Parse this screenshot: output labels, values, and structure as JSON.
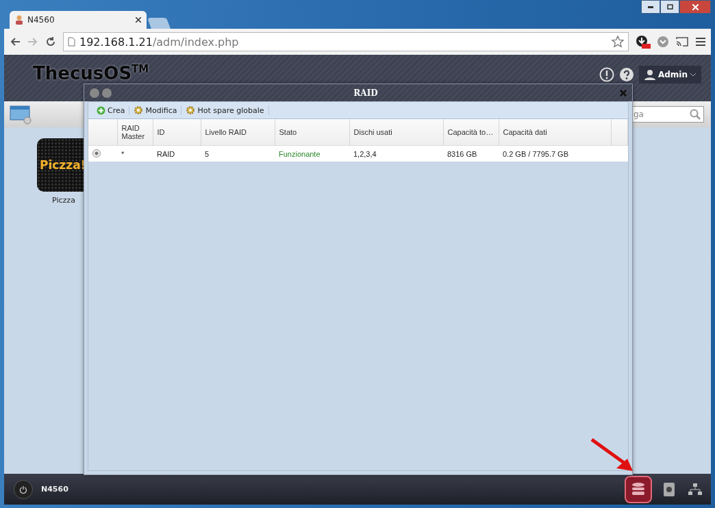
{
  "browser": {
    "tab": {
      "title": "N4560"
    },
    "url": {
      "host": "192.168.1.21",
      "path": "/adm/index.php"
    }
  },
  "header": {
    "logo": "ThecusOS$^{TM}$",
    "user": "Admin"
  },
  "search": {
    "placeholder": "ga"
  },
  "desktop": {
    "apps": [
      {
        "label": "Piczza",
        "logo": "Piczza!"
      }
    ]
  },
  "dialog": {
    "title": "RAID",
    "toolbar": [
      {
        "label": "Crea",
        "kind": "add"
      },
      {
        "label": "Modifica",
        "kind": "edit"
      },
      {
        "label": "Hot spare globale",
        "kind": "edit"
      }
    ],
    "table": {
      "columns": [
        "",
        "RAID Master",
        "ID",
        "Livello RAID",
        "Stato",
        "Dischi usati",
        "Capacità to…",
        "Capacità dati",
        ""
      ],
      "rows": [
        {
          "selected": true,
          "cells": [
            "",
            "*",
            "RAID",
            "5",
            "Funzionante",
            "1,2,3,4",
            "8316 GB",
            "0.2 GB / 7795.7 GB",
            ""
          ]
        }
      ]
    }
  },
  "taskbar": {
    "device": "N4560"
  }
}
